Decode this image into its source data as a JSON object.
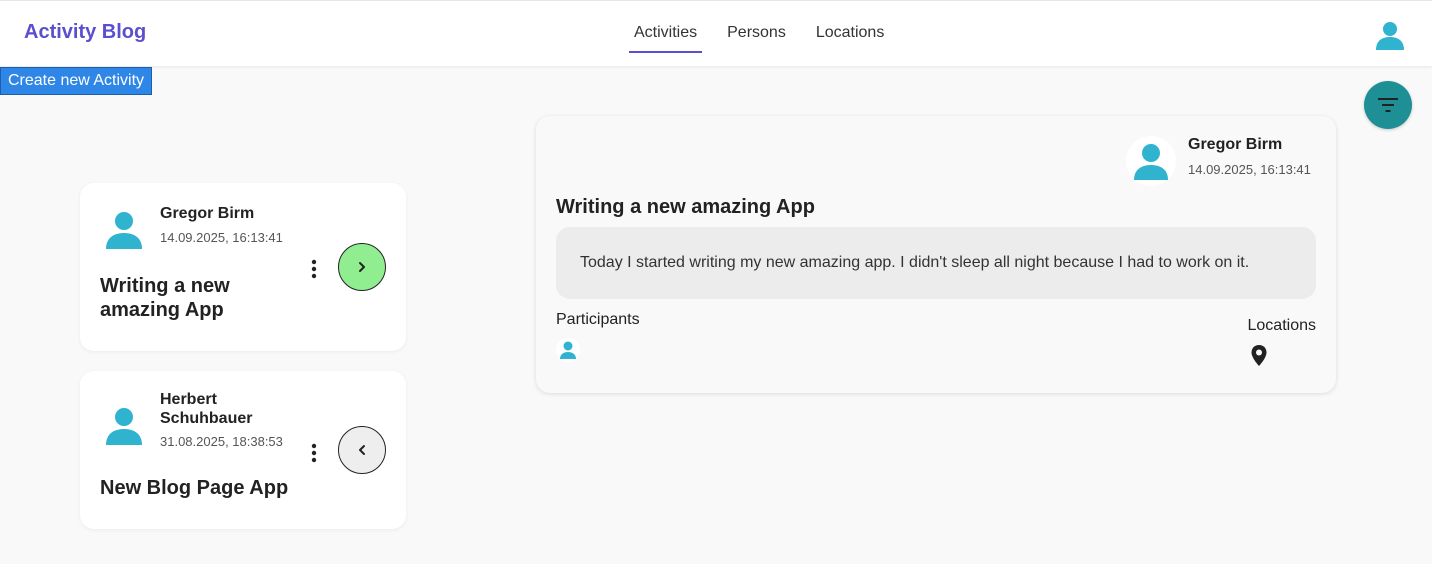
{
  "header": {
    "brand": "Activity Blog",
    "nav": [
      {
        "label": "Activities",
        "active": true
      },
      {
        "label": "Persons",
        "active": false
      },
      {
        "label": "Locations",
        "active": false
      }
    ]
  },
  "toolbar": {
    "create_label": "Create new Activity"
  },
  "activities": [
    {
      "author": "Gregor Birm",
      "date": "14.09.2025, 16:13:41",
      "title": "Writing a new amazing App",
      "nav_icon": "chevron-right-icon"
    },
    {
      "author": "Herbert Schuhbauer",
      "date": "31.08.2025, 18:38:53",
      "title": "New Blog Page App",
      "nav_icon": "chevron-left-icon"
    }
  ],
  "detail": {
    "author": "Gregor Birm",
    "date": "14.09.2025, 16:13:41",
    "title": "Writing a new amazing App",
    "body": "Today I started writing my new amazing app. I didn't sleep all night because I had to work on it.",
    "participants_label": "Participants",
    "locations_label": "Locations"
  },
  "colors": {
    "brand": "#5b4fcf",
    "accent_blue": "#2e86e6",
    "avatar": "#2fb3cf",
    "filter_button": "#1f8f96",
    "next_button": "#90ee90",
    "prev_button": "#eeeeee"
  },
  "icons": {
    "user": "user-avatar-icon",
    "filter": "filter-icon",
    "menu": "more-vertical-icon",
    "location": "map-pin-icon"
  }
}
